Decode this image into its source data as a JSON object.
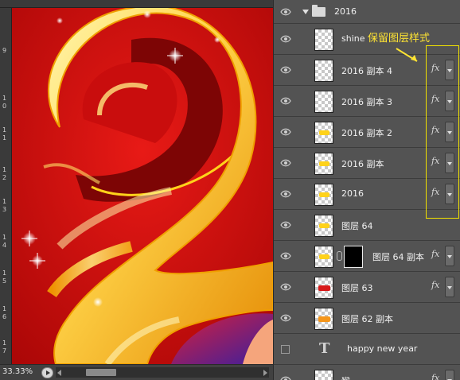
{
  "status": {
    "zoom": "33.33%"
  },
  "ruler": {
    "marks": [
      "9",
      "1",
      "0",
      "1",
      "1",
      "1",
      "2",
      "1",
      "3",
      "1",
      "4",
      "1",
      "5",
      "1",
      "6",
      "1",
      "7"
    ]
  },
  "layers_panel": {
    "group": {
      "name": "2016",
      "expanded": true
    },
    "annotation": "保留图层样式",
    "layers": [
      {
        "name": "shine",
        "has_fx": false
      },
      {
        "name": "2016 副本 4",
        "has_fx": true
      },
      {
        "name": "2016 副本 3",
        "has_fx": true
      },
      {
        "name": "2016 副本 2",
        "has_fx": true
      },
      {
        "name": "2016 副本",
        "has_fx": true
      },
      {
        "name": "2016",
        "has_fx": true
      },
      {
        "name": "图层 64",
        "has_fx": false
      },
      {
        "name": "图层 64 副本",
        "has_fx": true,
        "has_mask": true
      },
      {
        "name": "图层 63",
        "has_fx": true
      },
      {
        "name": "图层 62 副本",
        "has_fx": false
      },
      {
        "name": "happy new year",
        "type": "text",
        "visible": false
      },
      {
        "name": "猴",
        "has_fx": true
      }
    ],
    "fx_label": "fx"
  },
  "colors": {
    "panel_bg": "#535353",
    "canvas_bg": "#cc0a0a",
    "annotation": "#ffe433"
  }
}
